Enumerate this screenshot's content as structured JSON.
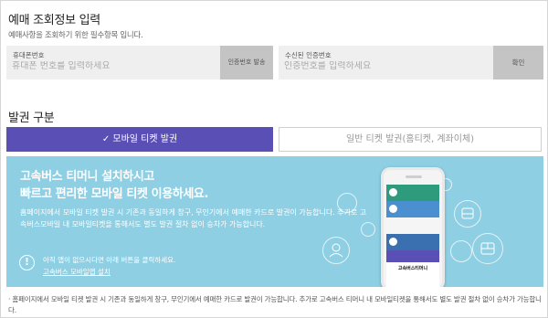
{
  "header": {
    "title": "예매 조회정보 입력",
    "subtitle": "예매사항을 조회하기 위한 필수항목 입니다."
  },
  "phone_field": {
    "label": "휴대폰번호",
    "placeholder": "휴대폰 번호를 입력하세요",
    "button_label": "인증번호 발송"
  },
  "code_field": {
    "label": "수신된 인증번호",
    "placeholder": "인증번호를 입력하세요",
    "button_label": "확인"
  },
  "ticket_section": {
    "title": "발권 구분",
    "tabs": [
      {
        "label": "✓ 모바일 티켓 발권",
        "selected": true
      },
      {
        "label": "일반 티켓 발권(홈티켓, 계좌이체)",
        "selected": false
      }
    ]
  },
  "banner": {
    "heading_line1": "고속버스 티머니 설치하시고",
    "heading_line2": "빠르고 편리한 모바일 티켓 이용하세요.",
    "description": "홈페이지에서 모바일 티켓 발권 시 기존과 동일하게 창구, 무인기에서 예매한 카드로 발권이 가능합니다. 추가로 고속버스모바일 내 모바일티켓을 통해서도 별도 발권 절차 없이 승차가 가능합니다.",
    "alert_text": "아직 앱이 없으시다면 아래 버튼을 클릭하세요.",
    "install_link": "고속버스 모바일앱 설치",
    "phone_logo": "고속버스티머니",
    "background_color": "#8fcfe3"
  },
  "footnote": "· 홈페이지에서 모바일 티켓 발권 시 기존과 동일하게 창구, 무인기에서 예매한 카드로 발권이 가능합니다. 추가로 고속버스 티머니 내 모바일티켓을 통해서도 별도 발권 절차 없이 승차가 가능합니다.",
  "colors": {
    "accent": "#5a4fb4",
    "field_bg": "#efefef",
    "button_bg": "#c4c4c4"
  }
}
